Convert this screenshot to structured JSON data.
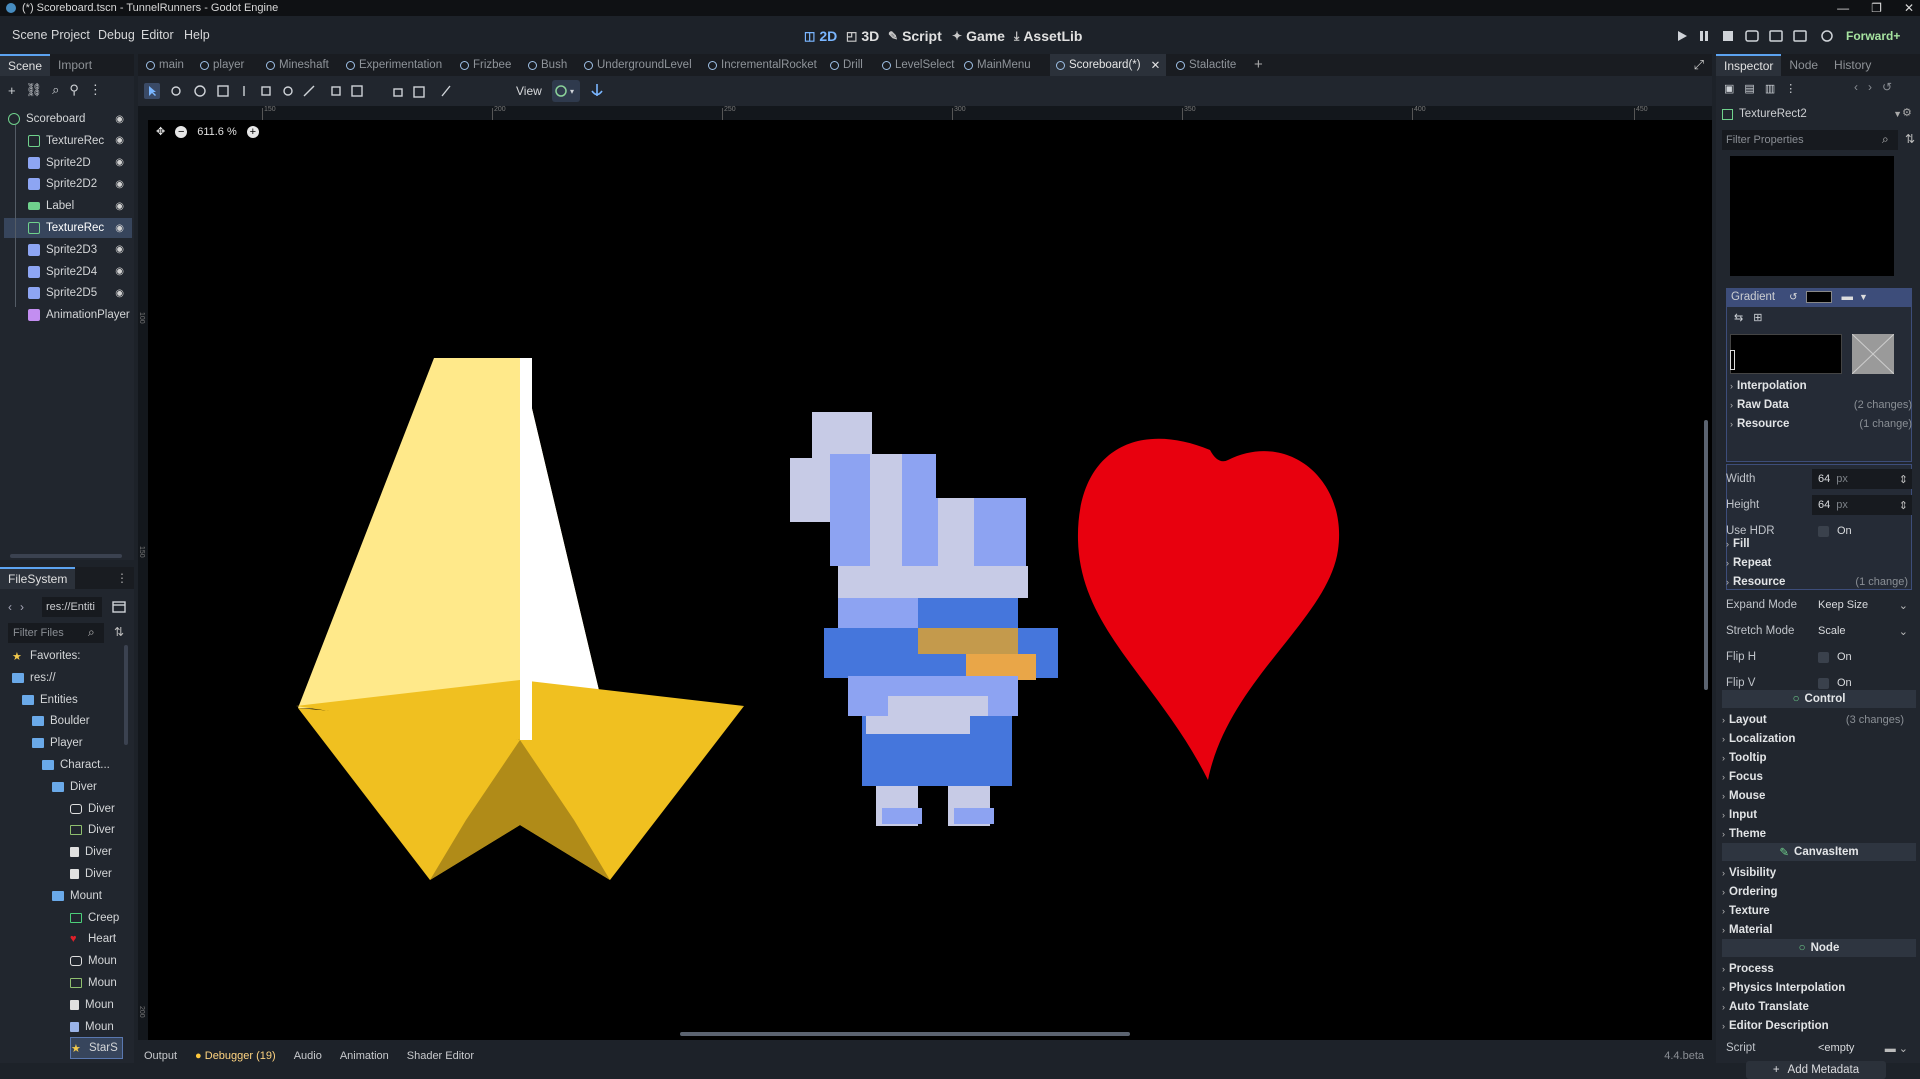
{
  "window": {
    "title": "(*) Scoreboard.tscn - TunnelRunners - Godot Engine",
    "controls": [
      "—",
      "❐",
      "✕"
    ]
  },
  "menu": [
    "Scene",
    "Project",
    "Debug",
    "Editor",
    "Help"
  ],
  "workspaces": [
    {
      "icon": "◫",
      "label": "2D"
    },
    {
      "icon": "◰",
      "label": "3D"
    },
    {
      "icon": "✎",
      "label": "Script"
    },
    {
      "icon": "✦",
      "label": "Game"
    },
    {
      "icon": "⤓",
      "label": "AssetLib"
    }
  ],
  "renderer": "Forward+",
  "scene_panel": {
    "tabs": [
      "Scene",
      "Import"
    ],
    "nodes": [
      {
        "name": "Scoreboard",
        "color": "#6fd18c",
        "kind": "circle"
      },
      {
        "name": "TextureRec",
        "color": "#6fd18c",
        "kind": "rect"
      },
      {
        "name": "Sprite2D",
        "color": "#8da5f3",
        "kind": "sprite"
      },
      {
        "name": "Sprite2D2",
        "color": "#8da5f3",
        "kind": "sprite"
      },
      {
        "name": "Label",
        "color": "#6fd18c",
        "kind": "label"
      },
      {
        "name": "TextureRec",
        "color": "#6fd18c",
        "kind": "rect"
      },
      {
        "name": "Sprite2D3",
        "color": "#8da5f3",
        "kind": "sprite"
      },
      {
        "name": "Sprite2D4",
        "color": "#8da5f3",
        "kind": "sprite"
      },
      {
        "name": "Sprite2D5",
        "color": "#8da5f3",
        "kind": "sprite"
      },
      {
        "name": "AnimationPlayer",
        "color": "#c38ef1",
        "kind": "anim"
      }
    ],
    "selected_index": 5
  },
  "filesystem": {
    "title": "FileSystem",
    "path": "res://Entiti",
    "filter_placeholder": "Filter Files",
    "items": [
      {
        "label": "Favorites:",
        "indent": 0,
        "icon": "star",
        "color": "#f2c94c"
      },
      {
        "label": "res://",
        "indent": 0,
        "icon": "folder",
        "color": "#6aa9e9"
      },
      {
        "label": "Entities",
        "indent": 1,
        "icon": "folder",
        "color": "#6aa9e9"
      },
      {
        "label": "Boulder",
        "indent": 2,
        "icon": "folder",
        "color": "#6aa9e9"
      },
      {
        "label": "Player",
        "indent": 2,
        "icon": "folder",
        "color": "#6aa9e9"
      },
      {
        "label": "Charact...",
        "indent": 3,
        "icon": "folder",
        "color": "#6aa9e9"
      },
      {
        "label": "Diver",
        "indent": 4,
        "icon": "folder",
        "color": "#6aa9e9"
      },
      {
        "label": "Diver",
        "indent": 5,
        "icon": "scene",
        "color": "#e0e0e0"
      },
      {
        "label": "Diver",
        "indent": 5,
        "icon": "image",
        "color": "#8fbf6f"
      },
      {
        "label": "Diver",
        "indent": 5,
        "icon": "file",
        "color": "#e0e0e0"
      },
      {
        "label": "Diver",
        "indent": 5,
        "icon": "file",
        "color": "#e0e0e0"
      },
      {
        "label": "Mount",
        "indent": 4,
        "icon": "folder",
        "color": "#6aa9e9"
      },
      {
        "label": "Creep",
        "indent": 5,
        "icon": "image",
        "color": "#4ccf7a"
      },
      {
        "label": "Heart",
        "indent": 5,
        "icon": "heart",
        "color": "#e0202a"
      },
      {
        "label": "Moun",
        "indent": 5,
        "icon": "scene",
        "color": "#e0e0e0"
      },
      {
        "label": "Moun",
        "indent": 5,
        "icon": "image",
        "color": "#8fbf6f"
      },
      {
        "label": "Moun",
        "indent": 5,
        "icon": "file",
        "color": "#e0e0e0"
      },
      {
        "label": "Moun",
        "indent": 5,
        "icon": "file",
        "color": "#9ab3e8"
      },
      {
        "label": "StarS",
        "indent": 5,
        "icon": "star",
        "color": "#f2c94c"
      }
    ],
    "selected_index": 18
  },
  "scene_tabs": [
    {
      "label": "main",
      "active": false
    },
    {
      "label": "player",
      "active": false
    },
    {
      "label": "Mineshaft",
      "active": false
    },
    {
      "label": "Experimentation",
      "active": false
    },
    {
      "label": "Frizbee",
      "active": false
    },
    {
      "label": "Bush",
      "active": false
    },
    {
      "label": "UndergroundLevel",
      "active": false
    },
    {
      "label": "IncrementalRocket",
      "active": false
    },
    {
      "label": "Drill",
      "active": false
    },
    {
      "label": "LevelSelect",
      "active": false
    },
    {
      "label": "MainMenu",
      "active": false
    },
    {
      "label": "Scoreboard(*)",
      "active": true
    },
    {
      "label": "Stalactite",
      "active": false
    }
  ],
  "viewport": {
    "view_menu": "View",
    "zoom": "611.6 %",
    "ruler_ticks": [
      "150",
      "200",
      "250",
      "300",
      "350",
      "400",
      "450"
    ],
    "left_ruler_ticks": [
      "100",
      "150",
      "200"
    ]
  },
  "bottom_tabs": [
    "Output",
    "Debugger (19)",
    "Audio",
    "Animation",
    "Shader Editor"
  ],
  "version": "4.4.beta",
  "inspector": {
    "tabs": [
      "Inspector",
      "Node",
      "History"
    ],
    "node_name": "TextureRect2",
    "filter_placeholder": "Filter Properties",
    "texture_type": "Gradient",
    "gradient_sections": [
      {
        "label": "Interpolation",
        "note": ""
      },
      {
        "label": "Raw Data",
        "note": "(2 changes)"
      },
      {
        "label": "Resource",
        "note": "(1 change)"
      }
    ],
    "props": [
      {
        "label": "Width",
        "value": "64",
        "unit": "px"
      },
      {
        "label": "Height",
        "value": "64",
        "unit": "px"
      },
      {
        "label": "Use HDR",
        "value": "On",
        "unit": ""
      }
    ],
    "tex_sections": [
      {
        "label": "Fill",
        "note": ""
      },
      {
        "label": "Repeat",
        "note": ""
      },
      {
        "label": "Resource",
        "note": "(1 change)"
      }
    ],
    "modes": [
      {
        "label": "Expand Mode",
        "value": "Keep Size"
      },
      {
        "label": "Stretch Mode",
        "value": "Scale"
      },
      {
        "label": "Flip H",
        "value": "On"
      },
      {
        "label": "Flip V",
        "value": "On"
      }
    ],
    "control_header": "Control",
    "control_sections": [
      {
        "label": "Layout",
        "note": "(3 changes)"
      },
      {
        "label": "Localization",
        "note": ""
      },
      {
        "label": "Tooltip",
        "note": ""
      },
      {
        "label": "Focus",
        "note": ""
      },
      {
        "label": "Mouse",
        "note": ""
      },
      {
        "label": "Input",
        "note": ""
      },
      {
        "label": "Theme",
        "note": ""
      }
    ],
    "canvasitem_header": "CanvasItem",
    "canvasitem_sections": [
      {
        "label": "Visibility",
        "note": ""
      },
      {
        "label": "Ordering",
        "note": ""
      },
      {
        "label": "Texture",
        "note": ""
      },
      {
        "label": "Material",
        "note": ""
      }
    ],
    "node_header": "Node",
    "node_sections": [
      {
        "label": "Process",
        "note": ""
      },
      {
        "label": "Physics Interpolation",
        "note": ""
      },
      {
        "label": "Auto Translate",
        "note": ""
      },
      {
        "label": "Editor Description",
        "note": ""
      }
    ],
    "script_label": "Script",
    "script_value": "<empty",
    "add_metadata": "Add Metadata"
  },
  "colors": {
    "star_light": "#ffe98a",
    "star_white": "#ffffff",
    "star_gold": "#f0c020",
    "star_dark": "#b08b18",
    "heart": "#e8000e",
    "robot_light": "#c7cbe6",
    "robot_mid": "#8da3f2",
    "robot_dark": "#4576dc",
    "robot_tan": "#c49a4c",
    "robot_orange": "#e9a648"
  }
}
